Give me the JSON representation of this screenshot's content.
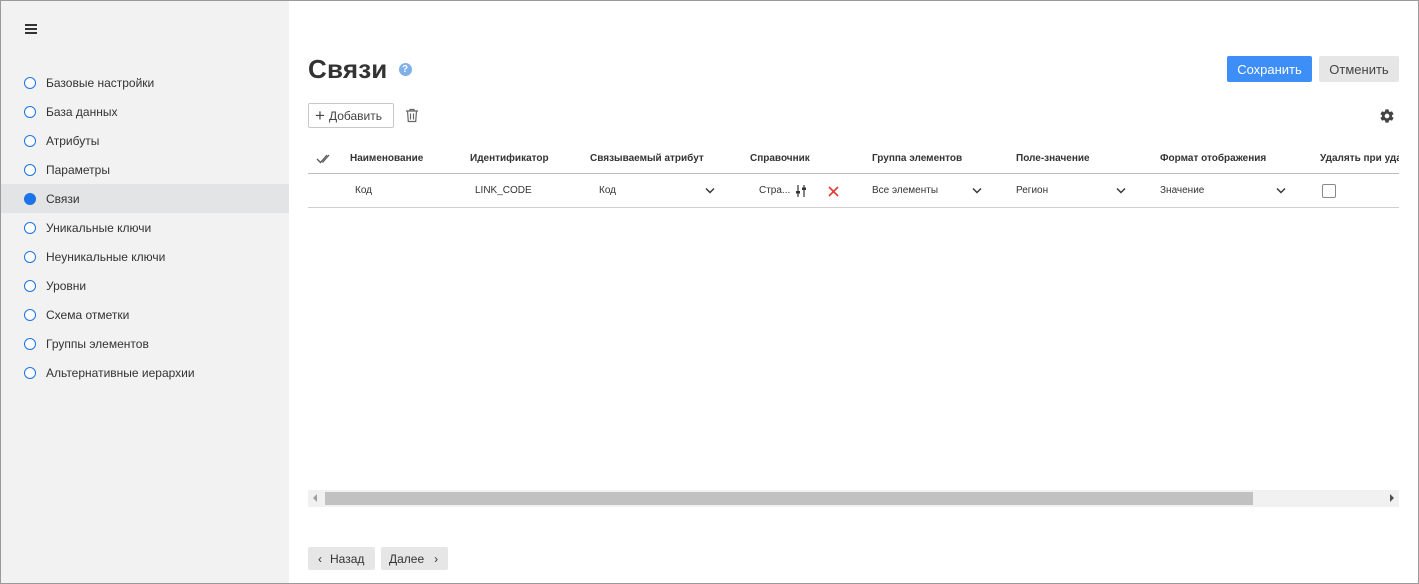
{
  "sidebar": {
    "menu_icon": "hamburger-icon",
    "items": [
      {
        "label": "Базовые настройки",
        "active": false
      },
      {
        "label": "База данных",
        "active": false
      },
      {
        "label": "Атрибуты",
        "active": false
      },
      {
        "label": "Параметры",
        "active": false
      },
      {
        "label": "Связи",
        "active": true
      },
      {
        "label": "Уникальные ключи",
        "active": false
      },
      {
        "label": "Неуникальные ключи",
        "active": false
      },
      {
        "label": "Уровни",
        "active": false
      },
      {
        "label": "Схема отметки",
        "active": false
      },
      {
        "label": "Группы элементов",
        "active": false
      },
      {
        "label": "Альтернативные иерархии",
        "active": false
      }
    ]
  },
  "header": {
    "title": "Связи",
    "help_icon": "question-icon",
    "save_label": "Сохранить",
    "cancel_label": "Отменить"
  },
  "toolbar": {
    "add_label": "Добавить",
    "add_icon": "plus-icon",
    "delete_icon": "trash-icon",
    "settings_icon": "gear-icon"
  },
  "table": {
    "select_all_icon": "double-check-icon",
    "columns": [
      "Наименование",
      "Идентификатор",
      "Связываемый атрибут",
      "Справочник",
      "Группа элементов",
      "Поле-значение",
      "Формат отображения",
      "Удалять при удал"
    ],
    "rows": [
      {
        "name": "Код",
        "identifier": "LINK_CODE",
        "linked_attribute": "Код",
        "dictionary": "Стра...",
        "element_group": "Все элементы",
        "value_field": "Регион",
        "display_format": "Значение",
        "delete_on_delete": false
      }
    ]
  },
  "footer": {
    "back_label": "Назад",
    "next_label": "Далее"
  },
  "colors": {
    "accent": "#3e8ef7",
    "sidebar_bg": "#f2f2f2",
    "active_item_bg": "#e3e4e6",
    "radio_blue": "#1a73e8",
    "remove_red": "#e53935"
  }
}
